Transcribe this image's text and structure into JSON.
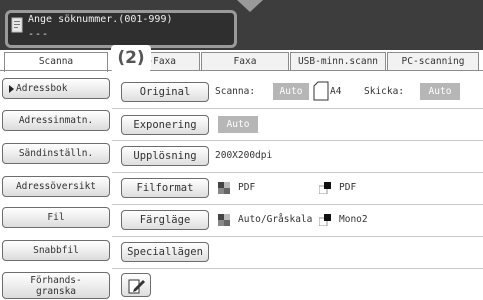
{
  "header": {
    "entry_prompt": "Ange söknummer.(001-999)",
    "entry_value": "---"
  },
  "callout_marker": "(2)",
  "tabs": [
    {
      "label": "Scanna",
      "active": true
    },
    {
      "label": "et-Faxa",
      "active": false
    },
    {
      "label": "Faxa",
      "active": false
    },
    {
      "label": "USB-minn.scann",
      "active": false
    },
    {
      "label": "PC-scanning",
      "active": false
    }
  ],
  "sidebar": {
    "items": [
      {
        "label": "Adressbok"
      },
      {
        "label": "Adressinmatn."
      },
      {
        "label": "Sändinställn."
      },
      {
        "label": "Adressöversikt"
      },
      {
        "label": "Fil"
      },
      {
        "label": "Snabbfil"
      },
      {
        "label_line1": "Förhands-",
        "label_line2": "granska"
      }
    ]
  },
  "settings": {
    "original": {
      "button": "Original",
      "scan_label": "Scanna:",
      "scan_value": "Auto",
      "size": "A4",
      "send_label": "Skicka:",
      "send_value": "Auto"
    },
    "exposure": {
      "button": "Exponering",
      "value": "Auto"
    },
    "resolution": {
      "button": "Upplösning",
      "value": "200X200dpi"
    },
    "file_format": {
      "button": "Filformat",
      "color_value": "PDF",
      "mono_value": "PDF"
    },
    "color_mode": {
      "button": "Färgläge",
      "color_value": "Auto/Gråskala",
      "mono_value": "Mono2"
    },
    "special": {
      "button": "Speciallägen"
    }
  },
  "icons": {
    "doc": "document-icon",
    "edit": "edit-icon"
  },
  "colors": {
    "header_bg": "#3d3d3d",
    "auto_bg": "#b6b6b6",
    "callout_border": "#9a9a9a"
  }
}
